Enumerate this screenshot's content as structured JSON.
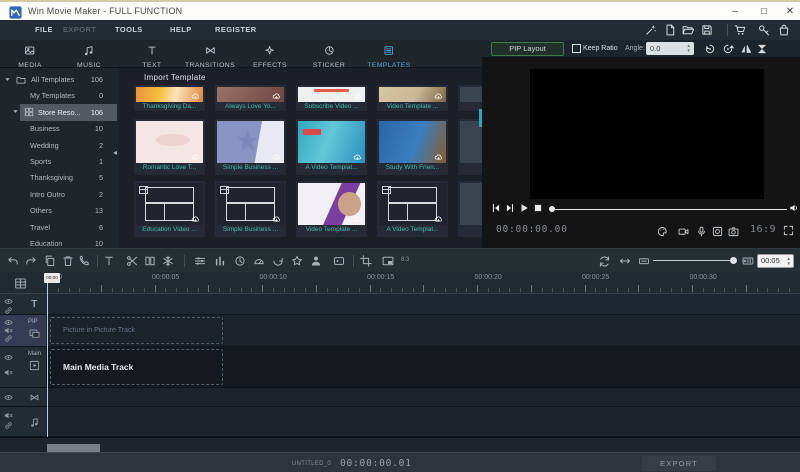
{
  "window": {
    "title": "Win Movie Maker - FULL FUNCTION",
    "controls": {
      "minimize": "–",
      "maximize": "□",
      "close": "✕"
    }
  },
  "menubar": {
    "items": [
      {
        "label": "FILE",
        "enabled": true
      },
      {
        "label": "EXPORT",
        "enabled": false
      },
      {
        "label": "TOOLS",
        "enabled": true
      },
      {
        "label": "HELP",
        "enabled": true
      },
      {
        "label": "REGISTER",
        "enabled": true
      }
    ],
    "quick_icons": [
      "wand",
      "new-file",
      "open-folder",
      "save",
      "|",
      "cart",
      "key",
      "bag"
    ]
  },
  "tabs": [
    {
      "label": "MEDIA",
      "icon": "media",
      "active": false
    },
    {
      "label": "MUSIC",
      "icon": "music",
      "active": false
    },
    {
      "label": "TEXT",
      "icon": "text-t",
      "active": false
    },
    {
      "label": "TRANSITIONS",
      "icon": "transitions",
      "active": false
    },
    {
      "label": "EFFECTS",
      "icon": "effects",
      "active": false
    },
    {
      "label": "STICKER",
      "icon": "sticker",
      "active": false
    },
    {
      "label": "TEMPLATES",
      "icon": "templates",
      "active": true
    }
  ],
  "sidebar": {
    "items": [
      {
        "label": "All Templates",
        "count": "106",
        "caret": true,
        "icon": "folder",
        "indent": 0,
        "selected": false
      },
      {
        "label": "My Templates",
        "count": "0",
        "caret": false,
        "icon": "",
        "indent": 1,
        "selected": false
      },
      {
        "label": "Store Reso...",
        "count": "106",
        "caret": true,
        "icon": "grid",
        "indent": 1,
        "selected": true
      },
      {
        "label": "Business",
        "count": "10",
        "caret": false,
        "icon": "",
        "indent": 2,
        "selected": false
      },
      {
        "label": "Wedding",
        "count": "2",
        "caret": false,
        "icon": "",
        "indent": 2,
        "selected": false
      },
      {
        "label": "Sports",
        "count": "1",
        "caret": false,
        "icon": "",
        "indent": 2,
        "selected": false
      },
      {
        "label": "Thanksgiving",
        "count": "5",
        "caret": false,
        "icon": "",
        "indent": 2,
        "selected": false
      },
      {
        "label": "Intro Outro",
        "count": "2",
        "caret": false,
        "icon": "",
        "indent": 2,
        "selected": false
      },
      {
        "label": "Others",
        "count": "13",
        "caret": false,
        "icon": "",
        "indent": 2,
        "selected": false
      },
      {
        "label": "Travel",
        "count": "6",
        "caret": false,
        "icon": "",
        "indent": 2,
        "selected": false
      },
      {
        "label": "Education",
        "count": "10",
        "caret": false,
        "icon": "",
        "indent": 2,
        "selected": false
      }
    ]
  },
  "templates_panel": {
    "header": "Import Template",
    "items": [
      {
        "name": "Thanksgiving Da...",
        "thumb": "th1"
      },
      {
        "name": "Always Love Yo...",
        "thumb": "th2"
      },
      {
        "name": "Subscribe Video ...",
        "thumb": "th3"
      },
      {
        "name": "Video Template ...",
        "thumb": "th4"
      },
      {
        "name": "",
        "thumb": "plain"
      },
      {
        "name": "Romantic Love T...",
        "thumb": "th5"
      },
      {
        "name": "Simple Business ...",
        "thumb": "th6"
      },
      {
        "name": "A Video Templat...",
        "thumb": "th7"
      },
      {
        "name": "Study With Frien...",
        "thumb": "th8"
      },
      {
        "name": "",
        "thumb": "plain"
      },
      {
        "name": "Education Video ...",
        "thumb": "layout"
      },
      {
        "name": "Simple Business ...",
        "thumb": "layout"
      },
      {
        "name": "Video Template ...",
        "thumb": "th11"
      },
      {
        "name": "A Video Templat...",
        "thumb": "layout"
      },
      {
        "name": "",
        "thumb": "plain"
      }
    ]
  },
  "preview": {
    "pip_layout_label": "PIP Layout",
    "keep_ratio_label": "Keep Ratio",
    "angle_label": "Angle:",
    "angle_value": "0.0",
    "timecode": "00:00:00.00",
    "aspect_ratio": "16:9"
  },
  "timeline": {
    "ruler_labels": [
      "00:00",
      "00:00:05",
      "00:00:10",
      "00:00:15",
      "00:00:20",
      "00:00:25",
      "00:00:30"
    ],
    "playhead_label": "00:00",
    "duration_value": "00:05",
    "ratio_badge": "8:3",
    "tracks": [
      {
        "name": "text-track",
        "label": ""
      },
      {
        "name": "pip-track",
        "label": "PIP"
      },
      {
        "name": "main-track",
        "label": "Main"
      },
      {
        "name": "transition-track",
        "label": ""
      },
      {
        "name": "audio-track",
        "label": ""
      }
    ],
    "pip_placeholder": "Picture in Picture Track",
    "main_placeholder": "Main Media Track"
  },
  "statusbar": {
    "project_name": "UNTITLED_0",
    "timecode": "00:00:00.01",
    "export_label": "EXPORT"
  }
}
